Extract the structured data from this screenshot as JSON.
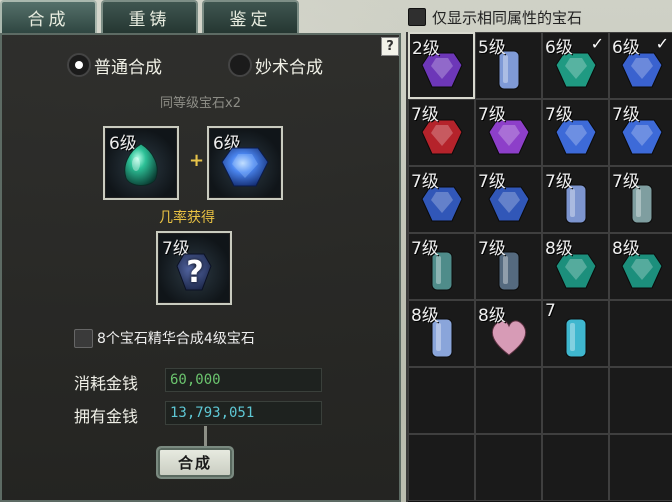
{
  "tabs": [
    {
      "label": "合成",
      "active": true
    },
    {
      "label": "重铸",
      "active": false
    },
    {
      "label": "鉴定",
      "active": false
    }
  ],
  "filter": {
    "label": "仅显示相同属性的宝石",
    "checked": false
  },
  "help_label": "?",
  "modes": {
    "normal": {
      "label": "普通合成",
      "selected": true
    },
    "skill": {
      "label": "妙术合成",
      "selected": false
    }
  },
  "subtitle": "同等级宝石x2",
  "input_slots": [
    {
      "level": "6级",
      "gem": "green-oval-gem-icon",
      "color": "#1fa57a"
    },
    {
      "level": "6级",
      "gem": "blue-faceted-gem-icon",
      "color": "#3b72e0"
    }
  ],
  "plus": "+",
  "result": {
    "caption": "几率获得",
    "level": "7级",
    "unknown": "?"
  },
  "essence": {
    "label": "8个宝石精华合成4级宝石",
    "checked": false
  },
  "money": {
    "cost_label": "消耗金钱",
    "cost_value": "60,000",
    "owned_label": "拥有金钱",
    "owned_value": "13,793,051"
  },
  "craft_button": "合成",
  "inventory": [
    {
      "level": "2级",
      "gem": "purple-gem-icon",
      "color": "#6d37b8",
      "checked": false,
      "selected": true
    },
    {
      "level": "5级",
      "gem": "blue-crystal-icon",
      "color": "#7f9ad6",
      "checked": false
    },
    {
      "level": "6级",
      "gem": "green-gem-icon",
      "color": "#1f9a82",
      "checked": true
    },
    {
      "level": "6级",
      "gem": "blue-gem-icon",
      "color": "#3a62cf",
      "checked": true
    },
    {
      "level": "7级",
      "gem": "red-gem-icon",
      "color": "#b5232b",
      "checked": false
    },
    {
      "level": "7级",
      "gem": "purple-gem-icon",
      "color": "#8d3fc9",
      "checked": false
    },
    {
      "level": "7级",
      "gem": "blue-gem-icon",
      "color": "#3d6ad8",
      "checked": false
    },
    {
      "level": "7级",
      "gem": "blue-gem-icon",
      "color": "#3d6ad8",
      "checked": false
    },
    {
      "level": "7级",
      "gem": "blue-gem-icon",
      "color": "#3157b8",
      "checked": false
    },
    {
      "level": "7级",
      "gem": "blue-gem-icon",
      "color": "#3157b8",
      "checked": false
    },
    {
      "level": "7级",
      "gem": "blue-crystal-icon",
      "color": "#7d95cf",
      "checked": false
    },
    {
      "level": "7级",
      "gem": "gray-crystal-icon",
      "color": "#7f9ea0",
      "checked": false
    },
    {
      "level": "7级",
      "gem": "teal-crystal-icon",
      "color": "#4f8c8a",
      "checked": false
    },
    {
      "level": "7级",
      "gem": "dark-crystal-icon",
      "color": "#556a7f",
      "checked": false
    },
    {
      "level": "8级",
      "gem": "green-gem-icon",
      "color": "#1c8f7c",
      "checked": false
    },
    {
      "level": "8级",
      "gem": "green-gem-icon",
      "color": "#1c8f7c",
      "checked": false
    },
    {
      "level": "8级",
      "gem": "blue-crystal-icon",
      "color": "#8aa5da",
      "checked": false
    },
    {
      "level": "8级",
      "gem": "pink-heart-gem-icon",
      "color": "#d79bb6",
      "checked": false
    },
    {
      "level": "7",
      "gem": "cyan-cluster-crystal-icon",
      "color": "#3fb7cf",
      "checked": false
    },
    {
      "level": "",
      "gem": "",
      "color": ""
    },
    {
      "level": "",
      "gem": "",
      "color": ""
    },
    {
      "level": "",
      "gem": "",
      "color": ""
    },
    {
      "level": "",
      "gem": "",
      "color": ""
    },
    {
      "level": "",
      "gem": "",
      "color": ""
    },
    {
      "level": "",
      "gem": "",
      "color": ""
    },
    {
      "level": "",
      "gem": "",
      "color": ""
    },
    {
      "level": "",
      "gem": "",
      "color": ""
    },
    {
      "level": "",
      "gem": "",
      "color": ""
    }
  ]
}
